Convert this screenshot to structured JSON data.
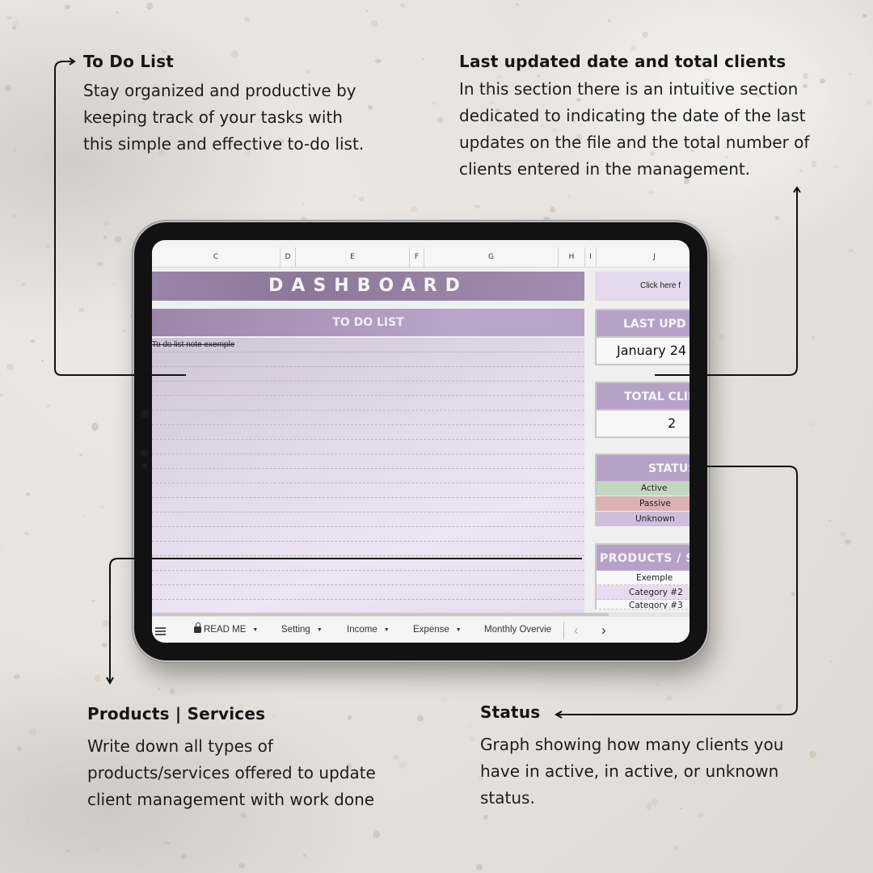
{
  "callouts": {
    "todo": {
      "title": "To Do List",
      "body": "Stay organized and productive by keeping track of your tasks with this simple and effective to-do list."
    },
    "last_updated": {
      "title": "Last updated date and total clients",
      "body": "In this section there is an intuitive section dedicated to indicating the date of the last updates on the file and the total number of clients entered in the management."
    },
    "products": {
      "title": "Products | Services",
      "body": "Write down all types of products/services offered to update client management with work done"
    },
    "status": {
      "title": "Status",
      "body": "Graph showing how many clients you have in active, in active, or unknown status."
    }
  },
  "spreadsheet": {
    "columns": [
      "C",
      "D",
      "E",
      "F",
      "G",
      "H",
      "I",
      "J"
    ],
    "dashboard_title": "DASHBOARD",
    "click_here_text": "Click here f",
    "todo": {
      "header": "TO DO LIST",
      "items": [
        {
          "text": "To do list note exemple",
          "done": true
        },
        {
          "text": "",
          "done": false
        },
        {
          "text": "",
          "done": false
        },
        {
          "text": "",
          "done": false
        },
        {
          "text": "",
          "done": false
        },
        {
          "text": "",
          "done": false
        },
        {
          "text": "",
          "done": false
        },
        {
          "text": "",
          "done": false
        },
        {
          "text": "",
          "done": false
        },
        {
          "text": "",
          "done": false
        },
        {
          "text": "",
          "done": false
        },
        {
          "text": "",
          "done": false
        },
        {
          "text": "",
          "done": false
        },
        {
          "text": "",
          "done": false
        },
        {
          "text": "",
          "done": false
        },
        {
          "text": "",
          "done": false
        },
        {
          "text": "",
          "done": false
        },
        {
          "text": "",
          "done": false
        }
      ]
    },
    "last_update": {
      "header": "LAST UPD",
      "value": "January 24"
    },
    "total_clients": {
      "header": "TOTAL CLIE",
      "value": "2"
    },
    "status": {
      "header": "STATUS",
      "items": [
        {
          "label": "Active",
          "color": "#c3d6c0"
        },
        {
          "label": "Passive",
          "color": "#dcb1b3"
        },
        {
          "label": "Unknown",
          "color": "#cdbfdb"
        }
      ]
    },
    "products": {
      "header": "PRODUCTS / S",
      "items": [
        "Exemple",
        "Category #2",
        "Category #3"
      ]
    },
    "colors": {
      "banner": "#9a84a8",
      "section_header": "#b6a2c7",
      "todo_bg": "#e8def0"
    }
  },
  "sheet_tabs": {
    "menu_icon": "hamburger-menu-icon",
    "tabs": [
      {
        "label": "READ ME",
        "locked": true
      },
      {
        "label": "Setting",
        "locked": false
      },
      {
        "label": "Income",
        "locked": false
      },
      {
        "label": "Expense",
        "locked": false
      },
      {
        "label": "Monthly Overvie",
        "locked": false
      }
    ],
    "prev_label": "‹",
    "next_label": "›"
  }
}
